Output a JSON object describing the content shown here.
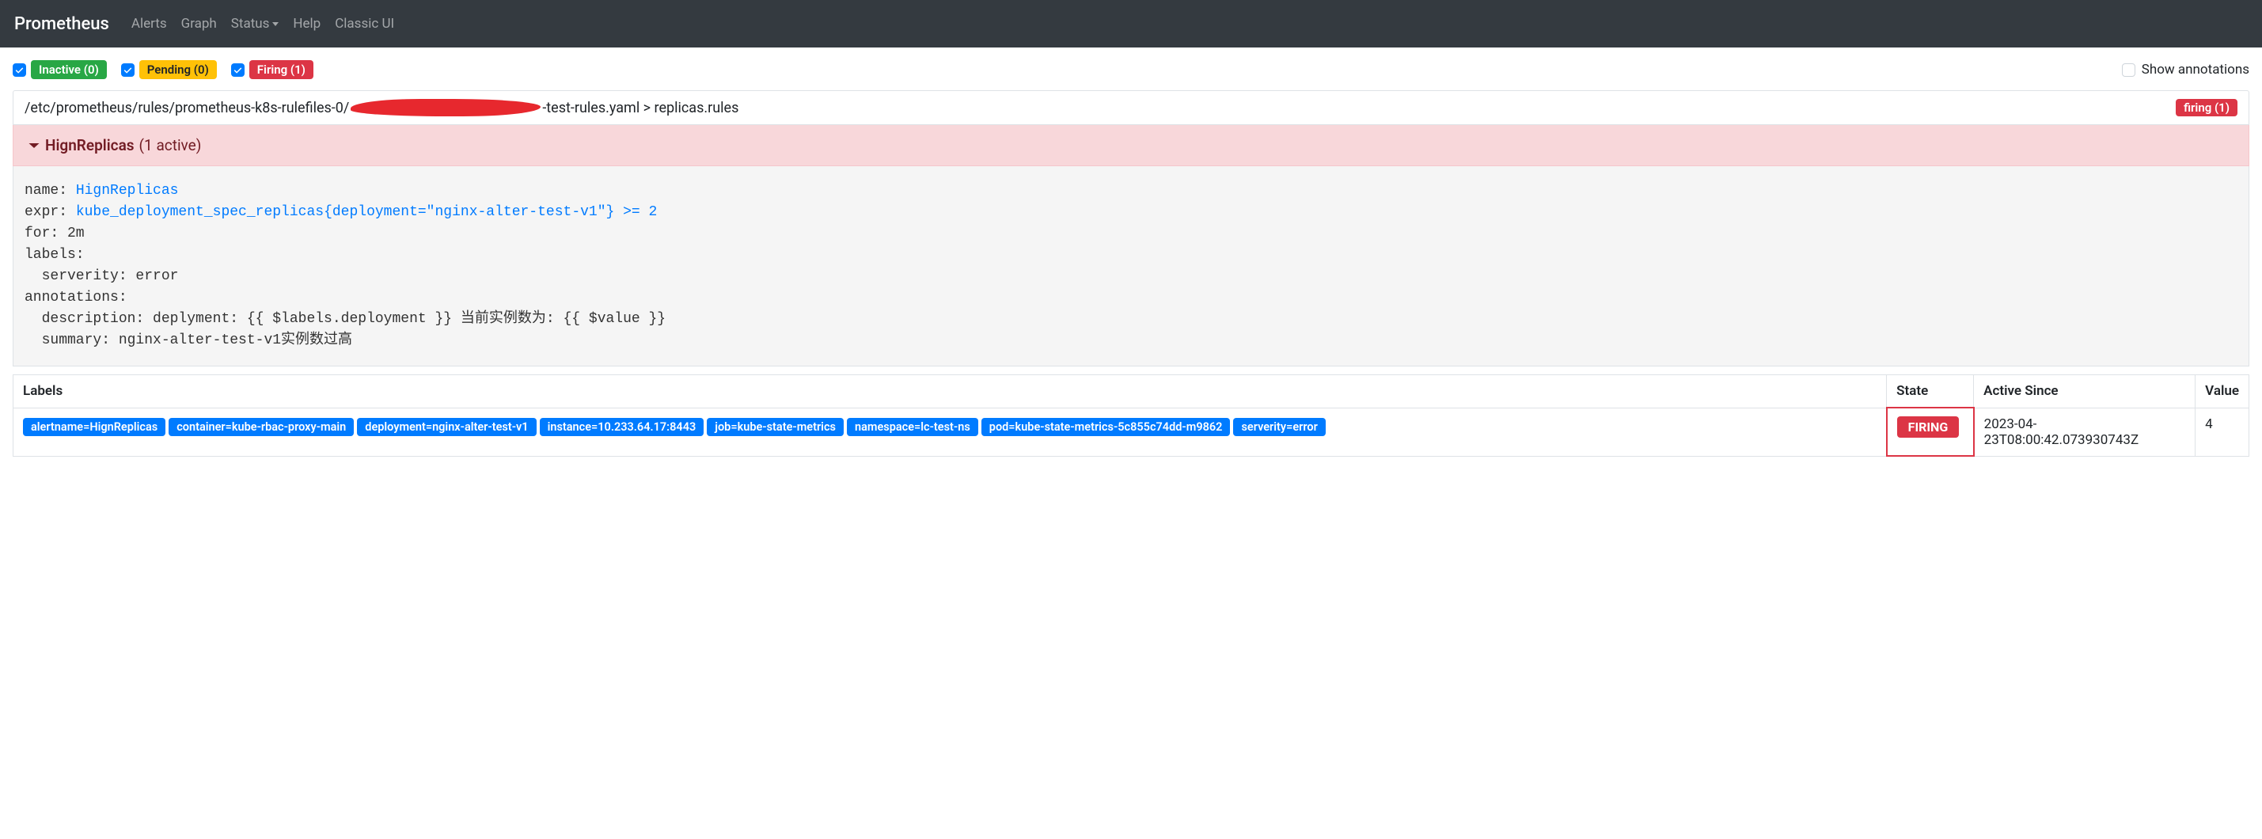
{
  "nav": {
    "brand": "Prometheus",
    "links": [
      "Alerts",
      "Graph",
      "Status",
      "Help",
      "Classic UI"
    ],
    "status_has_dropdown": true
  },
  "filters": {
    "inactive": {
      "label": "Inactive (0)",
      "checked": true
    },
    "pending": {
      "label": "Pending (0)",
      "checked": true
    },
    "firing": {
      "label": "Firing (1)",
      "checked": true
    },
    "show_annotations": {
      "label": "Show annotations",
      "checked": false
    }
  },
  "rule_group": {
    "path_prefix": "/etc/prometheus/rules/prometheus-k8s-rulefiles-0/",
    "path_suffix": "-test-rules.yaml > replicas.rules",
    "firing_badge": "firing (1)"
  },
  "alert": {
    "name": "HignReplicas",
    "active_text": "(1 active)",
    "definition_lines": [
      {
        "prefix": "name: ",
        "link_text": "HignReplicas",
        "suffix": ""
      },
      {
        "prefix": "expr: ",
        "link_text": "kube_deployment_spec_replicas{deployment=\"nginx-alter-test-v1\"} >= 2",
        "suffix": ""
      },
      {
        "prefix": "for: 2m",
        "link_text": "",
        "suffix": ""
      },
      {
        "prefix": "labels:",
        "link_text": "",
        "suffix": ""
      },
      {
        "prefix": "  serverity: error",
        "link_text": "",
        "suffix": ""
      },
      {
        "prefix": "annotations:",
        "link_text": "",
        "suffix": ""
      },
      {
        "prefix": "  description: deplyment: {{ $labels.deployment }} 当前实例数为: {{ $value }}",
        "link_text": "",
        "suffix": ""
      },
      {
        "prefix": "  summary: nginx-alter-test-v1实例数过高",
        "link_text": "",
        "suffix": ""
      }
    ]
  },
  "table": {
    "headers": {
      "labels": "Labels",
      "state": "State",
      "active_since": "Active Since",
      "value": "Value"
    },
    "row": {
      "labels": [
        "alertname=HignReplicas",
        "container=kube-rbac-proxy-main",
        "deployment=nginx-alter-test-v1",
        "instance=10.233.64.17:8443",
        "job=kube-state-metrics",
        "namespace=lc-test-ns",
        "pod=kube-state-metrics-5c855c74dd-m9862",
        "serverity=error"
      ],
      "state": "FIRING",
      "active_since": "2023-04-23T08:00:42.073930743Z",
      "value": "4"
    }
  }
}
